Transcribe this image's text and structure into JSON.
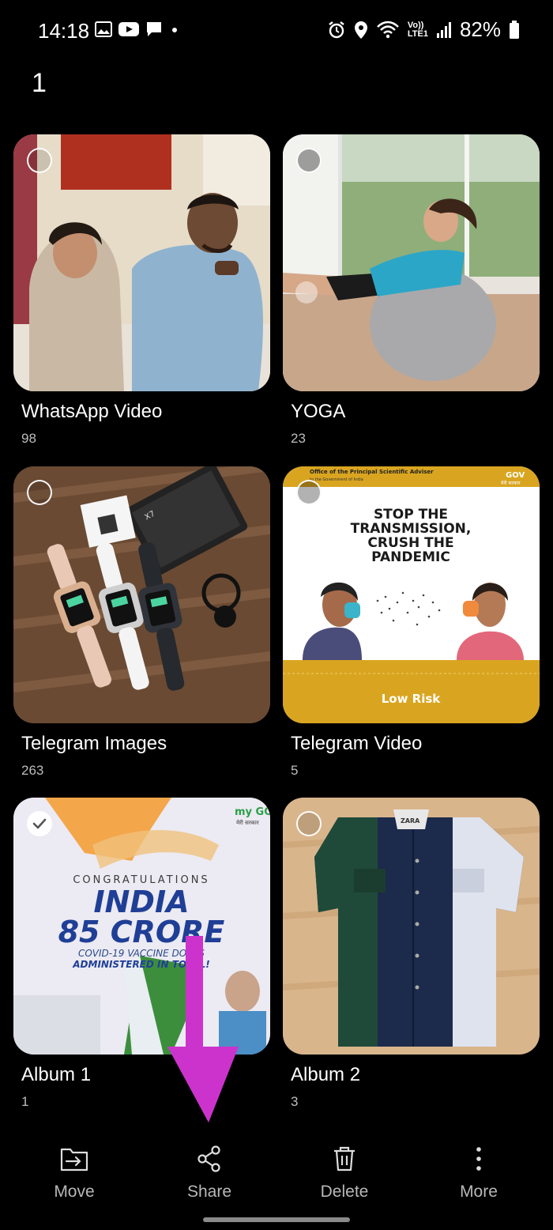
{
  "status_bar": {
    "time": "14:18",
    "left_icons": [
      "gallery-notification-icon",
      "youtube-notification-icon",
      "message-notification-icon",
      "dot-icon"
    ],
    "right_icons": [
      "alarm-icon",
      "location-icon",
      "wifi-calling-icon",
      "volte-lte-icon",
      "signal-icon"
    ],
    "volte_label": "Vo))",
    "lte_label": "LTE1",
    "battery_percent": "82%"
  },
  "selection": {
    "count": "1"
  },
  "albums": [
    {
      "name": "WhatsApp Video",
      "count": "98",
      "selected": false
    },
    {
      "name": "YOGA",
      "count": "23",
      "selected": false
    },
    {
      "name": "Telegram Images",
      "count": "263",
      "selected": false
    },
    {
      "name": "Telegram Video",
      "count": "5",
      "selected": false
    },
    {
      "name": "Album 1",
      "count": "1",
      "selected": true
    },
    {
      "name": "Album 2",
      "count": "3",
      "selected": false
    }
  ],
  "thumbnails": {
    "telegram_video": {
      "header": "Office of the Principal Scientific Adviser",
      "header_sub": "to the Government of India",
      "logo": "GOV",
      "logo_sub": "मेरी सरकार",
      "headline": [
        "STOP THE",
        "TRANSMISSION,",
        "CRUSH THE",
        "PANDEMIC"
      ],
      "footer": "Low Risk"
    },
    "album_1": {
      "logo": "my GOV",
      "logo_sub": "मेरी सरकार",
      "line1": "CONGRATULATIONS",
      "line2": "INDIA",
      "line3": "85 CRORE",
      "line4": "COVID-19 VACCINE DOSES",
      "line5": "ADMINISTERED IN TOTAL!"
    },
    "telegram_images": {
      "box_label": "X7"
    },
    "album_2": {
      "tag_label": "ZARA"
    }
  },
  "actions": {
    "move": "Move",
    "share": "Share",
    "delete": "Delete",
    "more": "More"
  },
  "colors": {
    "background": "#000000",
    "annotation_arrow": "#CC33CC",
    "label_gray": "#B8B8B8",
    "count_gray": "#BDBDBD"
  }
}
